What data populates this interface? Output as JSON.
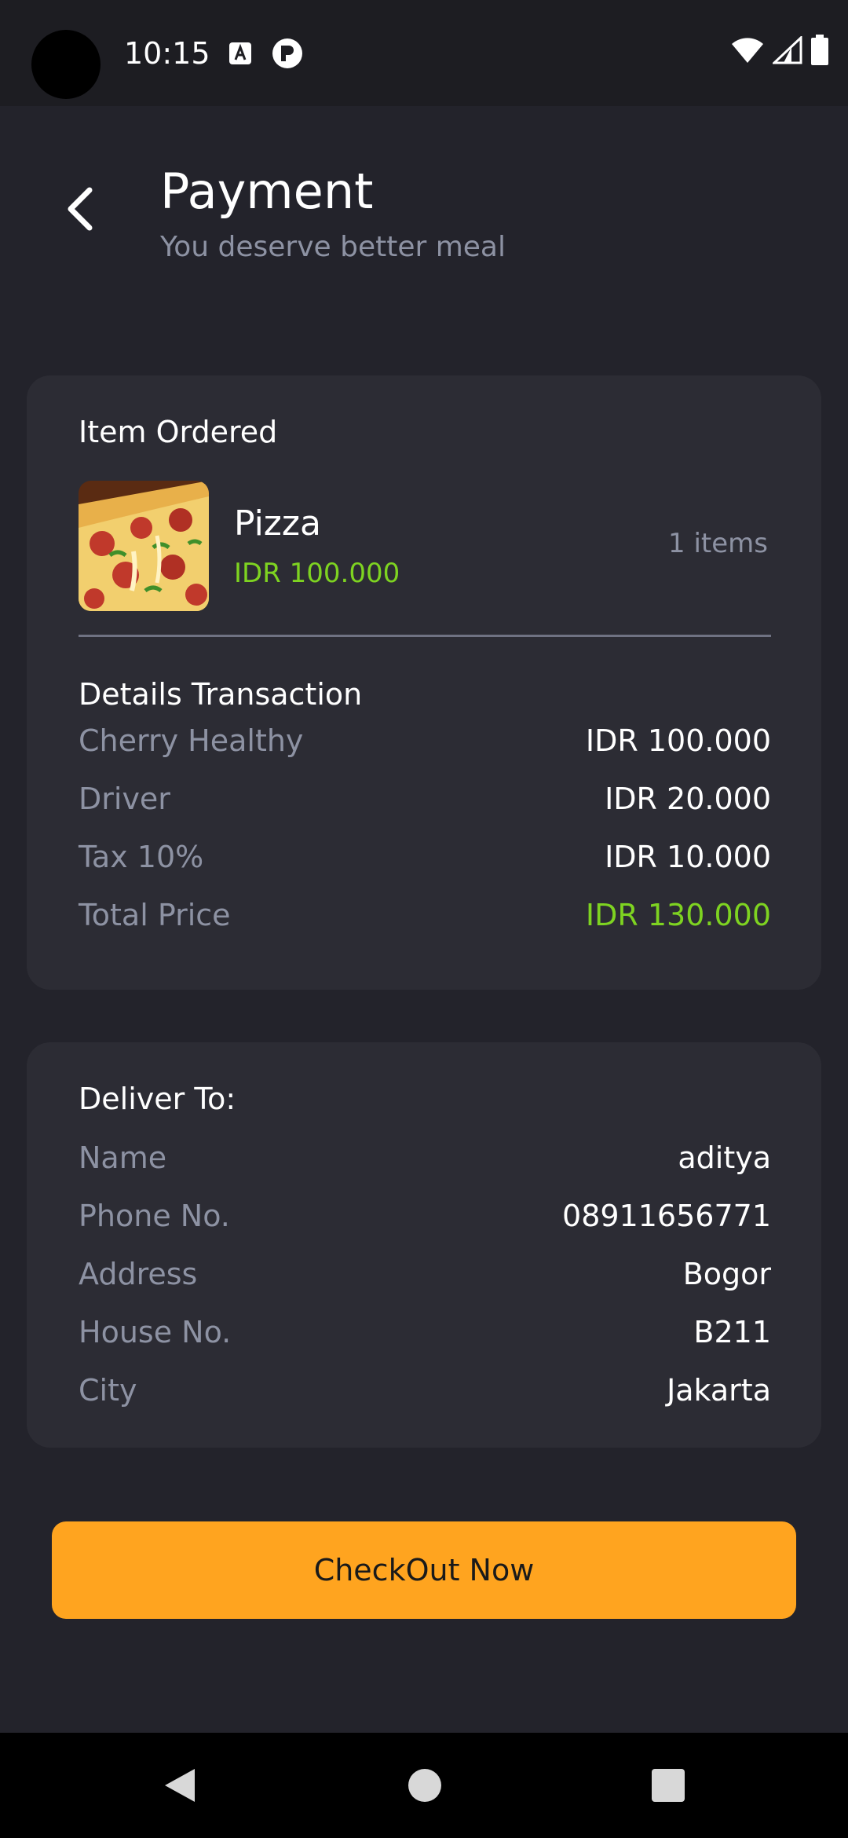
{
  "status_bar": {
    "time": "10:15",
    "icons": [
      "a-notification-icon",
      "r-notification-icon",
      "wifi-icon",
      "signal-icon",
      "battery-icon"
    ]
  },
  "header": {
    "back_icon": "chevron-left-icon",
    "title": "Payment",
    "subtitle": "You deserve better meal"
  },
  "order": {
    "section_title": "Item Ordered",
    "item": {
      "name": "Pizza",
      "price": "IDR 100.000",
      "quantity": "1 items",
      "image": "pizza-photo"
    }
  },
  "transaction": {
    "section_title": "Details Transaction",
    "rows": [
      {
        "label": "Cherry Healthy",
        "value": "IDR 100.000"
      },
      {
        "label": "Driver",
        "value": "IDR 20.000"
      },
      {
        "label": "Tax 10%",
        "value": "IDR 10.000"
      },
      {
        "label": "Total Price",
        "value": "IDR 130.000"
      }
    ]
  },
  "delivery": {
    "section_title": "Deliver To:",
    "rows": [
      {
        "label": "Name",
        "value": "aditya"
      },
      {
        "label": "Phone No.",
        "value": "08911656771"
      },
      {
        "label": "Address",
        "value": "Bogor"
      },
      {
        "label": "House No.",
        "value": "B211"
      },
      {
        "label": "City",
        "value": "Jakarta"
      }
    ]
  },
  "checkout": {
    "label": "CheckOut Now"
  },
  "colors": {
    "background": "#23232b",
    "card": "#2c2c34",
    "accent": "#ffa41f",
    "price_green": "#7ed321",
    "muted_text": "#8d92a3"
  },
  "nav_bar": {
    "icons": [
      "nav-back-icon",
      "nav-home-icon",
      "nav-recents-icon"
    ]
  }
}
